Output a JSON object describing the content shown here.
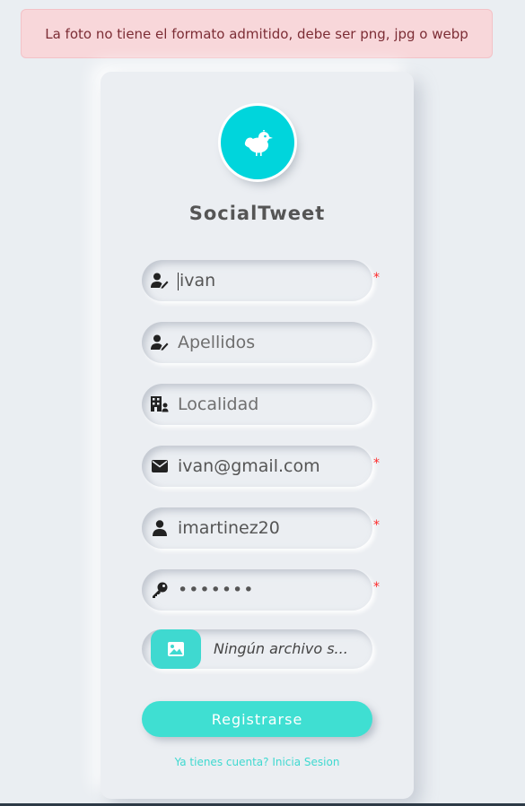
{
  "alert": {
    "message": "La foto no tiene el formato admitido, debe ser png, jpg o webp"
  },
  "brand": {
    "name": "SocialTweet"
  },
  "form": {
    "nombre": {
      "value": "ivan",
      "required": "*",
      "icon": "user-edit-icon"
    },
    "apellidos": {
      "placeholder": "Apellidos",
      "icon": "user-edit-icon"
    },
    "localidad": {
      "placeholder": "Localidad",
      "icon": "building-user-icon"
    },
    "email": {
      "value": "ivan@gmail.com",
      "required": "*",
      "icon": "envelope-icon"
    },
    "usuario": {
      "value": "imartinez20",
      "required": "*",
      "icon": "user-icon"
    },
    "password": {
      "value": "•••••••",
      "required": "*",
      "icon": "key-icon"
    },
    "foto": {
      "status": "Ningún archivo s...",
      "icon": "image-icon"
    },
    "submit_label": "Registrarse",
    "login_link": "Ya tienes cuenta? Inicia Sesion"
  },
  "colors": {
    "accent": "#3fdfd2",
    "logo_bg": "#00d5dc",
    "alert_bg": "#f8d7da",
    "alert_text": "#7c2d35",
    "required": "#ff2b2b"
  }
}
